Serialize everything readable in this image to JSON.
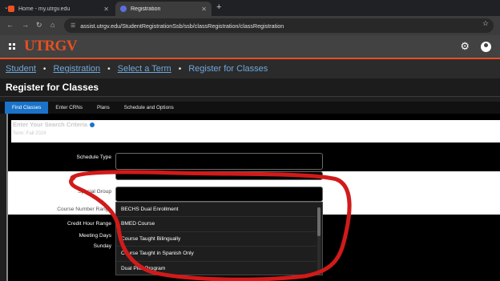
{
  "browser": {
    "tabs": [
      {
        "label": "Home - my.utrgv.edu",
        "active": false
      },
      {
        "label": "Registration",
        "active": true
      }
    ],
    "url": "assist.utrgv.edu/StudentRegistrationSsb/ssb/classRegistration/classRegistration"
  },
  "header": {
    "logo_ut": "UT",
    "logo_rgv": "RGV",
    "brand_color": "#e8501f"
  },
  "breadcrumb": {
    "items": [
      "Student",
      "Registration",
      "Select a Term",
      "Register for Classes"
    ]
  },
  "page": {
    "title": "Register for Classes",
    "tabs": [
      "Find Classes",
      "Enter CRNs",
      "Plans",
      "Schedule and Options"
    ],
    "active_tab": "Find Classes"
  },
  "search": {
    "heading": "Enter Your Search Criteria",
    "term": "Term: Fall 2024",
    "fields": {
      "schedule_type": "Schedule Type",
      "special_group": "Special Group",
      "course_number_range": "Course Number Range",
      "credit_hour_range": "Credit Hour Range",
      "meeting_days": "Meeting Days",
      "sunday": "Sunday"
    },
    "dropdown_options": [
      "BECHS Dual Enrollment",
      "BMED Course",
      "Course Taught Bilingually",
      "Course Taught in Spanish Only",
      "Dual Pilot Program"
    ]
  },
  "annotation": {
    "color": "#d11a1a"
  }
}
